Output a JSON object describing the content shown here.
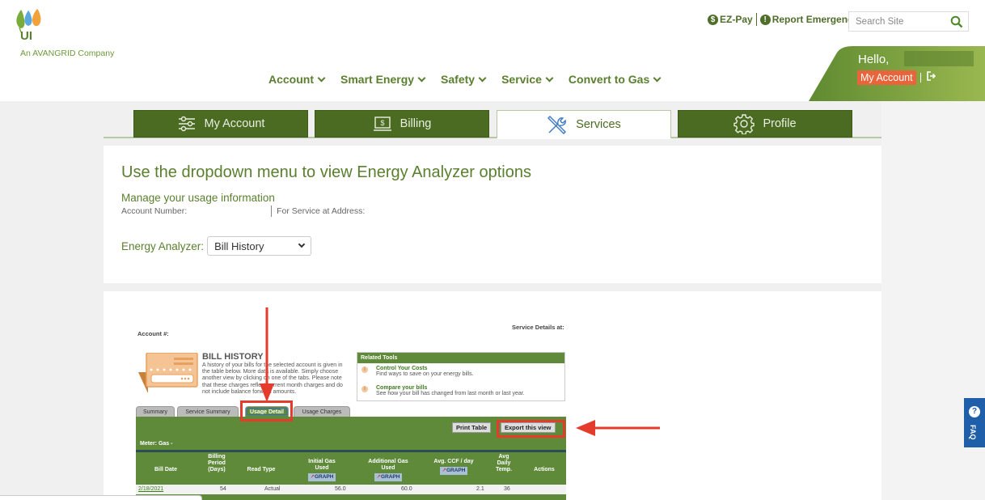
{
  "brand": {
    "logo_text": "UI",
    "tagline": "An AVANGRID Company",
    "colors": {
      "primary_green": "#5a7f2e",
      "tab_green": "#4b6a22",
      "accent_orange": "#e8643a",
      "annotation_red": "#e43b2c",
      "faq_blue": "#1f5ea8"
    }
  },
  "utility": {
    "ezpay": {
      "icon": "dollar-icon",
      "label": "EZ-Pay"
    },
    "emergency": {
      "icon": "exclamation-icon",
      "label": "Report Emergency"
    },
    "search_placeholder": "Search Site"
  },
  "nav": {
    "items": [
      {
        "label": "Account"
      },
      {
        "label": "Smart Energy"
      },
      {
        "label": "Safety"
      },
      {
        "label": "Service"
      },
      {
        "label": "Convert to Gas"
      }
    ]
  },
  "greeting": {
    "hello": "Hello,",
    "my_account": "My Account"
  },
  "account_tabs": [
    {
      "label": "My Account",
      "icon": "sliders-icon",
      "active": false
    },
    {
      "label": "Billing",
      "icon": "laptop-dollar-icon",
      "active": false
    },
    {
      "label": "Services",
      "icon": "wrench-screwdriver-icon",
      "active": true
    },
    {
      "label": "Profile",
      "icon": "gear-icon",
      "active": false
    }
  ],
  "analyzer": {
    "title": "Use the dropdown menu to view Energy Analyzer options",
    "subtitle": "Manage your usage information",
    "account_number_label": "Account Number:",
    "service_address_label": "For Service at Address:",
    "select_label": "Energy Analyzer:",
    "select_value": "Bill History"
  },
  "bill_history": {
    "account_label": "Account #:",
    "service_details_label": "Service Details at:",
    "title": "BILL HISTORY",
    "description": "A history of your bills for the selected account is given in the table below. More data is available. Simply choose another view by clicking on one of the tabs. Please note that these charges reflect current month charges and do not include balance forward amounts.",
    "related_tools": {
      "heading": "Related Tools",
      "items": [
        {
          "title": "Control Your Costs",
          "desc": "Find ways to save on your energy bills."
        },
        {
          "title": "Compare your bills",
          "desc": "See how your bill has changed from last month or last year."
        }
      ]
    },
    "tabs": [
      {
        "label": "Summary",
        "active": false
      },
      {
        "label": "Service Summary",
        "active": false
      },
      {
        "label": "Usage Detail",
        "active": true
      },
      {
        "label": "Usage Charges",
        "active": false
      }
    ],
    "print_label": "Print Table",
    "export_label": "Export this view",
    "meter_label": "Meter: Gas -",
    "graph_label": "GRAPH",
    "columns": [
      {
        "label": "Bill Date"
      },
      {
        "label": "Billing Period (Days)"
      },
      {
        "label": "Read Type"
      },
      {
        "label": "Initial Gas Used",
        "graph": true
      },
      {
        "label": "Additional Gas Used",
        "graph": true
      },
      {
        "label": "Avg. CCF / day",
        "graph": true
      },
      {
        "label": "Avg Daily Temp."
      },
      {
        "label": "Actions"
      }
    ],
    "rows": [
      {
        "bill_date": "2/18/2021",
        "period": "54",
        "read_type": "Actual",
        "initial": "56.0",
        "additional": "60.0",
        "avg_ccf": "2.1",
        "temp": "36",
        "actions": ""
      }
    ]
  },
  "faq": {
    "label": "FAQ"
  }
}
